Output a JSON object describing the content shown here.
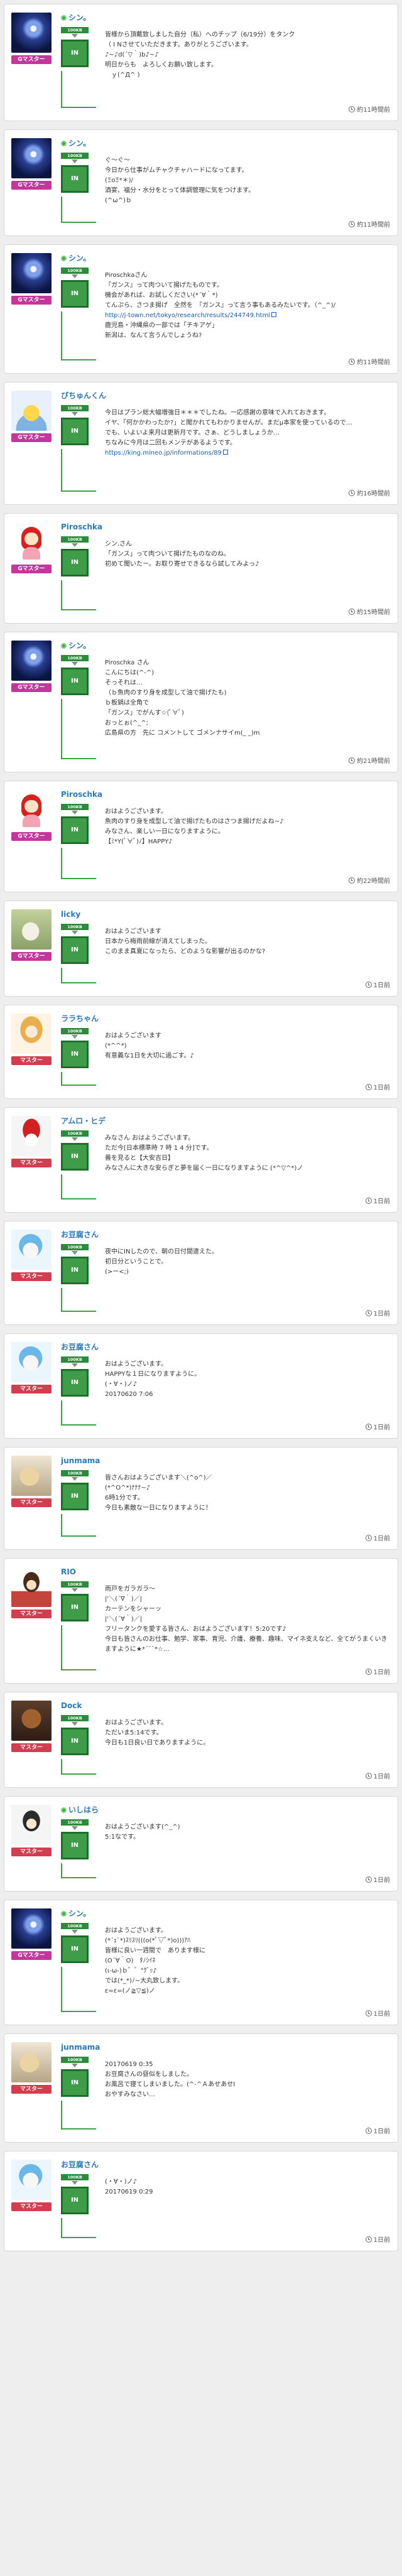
{
  "badge": {
    "top_label": "100KB",
    "main_label": "IN"
  },
  "posts": [
    {
      "name": "シン。",
      "name_flower": true,
      "avatar": "shin",
      "rank": "Gマスター",
      "rank_style": "gm",
      "message": "皆様から頂戴致しました自分（私）へのチップ（6/19分）をタンク\n（ I Nさせていただきます。ありがとうございます。\n♪~♪d(´▽｀)b♪~♪\n明日からも　よろしくお願い致します。\n　ｙ(^Д^ )",
      "time": "約11時間前"
    },
    {
      "name": "シン。",
      "name_flower": true,
      "avatar": "shin",
      "rank": "Gマスター",
      "rank_style": "gm",
      "message": "ぐ～ぐ～\n今日から仕事がムチャクチャハードになってます。\n(ΞoΞ*＊)/\n酒宴、福分・水分をとって体調管理に気をつけます。\n(^ω^)ｂ",
      "time": "約11時間前"
    },
    {
      "name": "シン。",
      "name_flower": true,
      "avatar": "shin",
      "rank": "Gマスター",
      "rank_style": "gm",
      "message": "Piroschkaさん\n『ガンス』って肉ついて揚げたものです。\n機会があれば、お試しください(*´∀｀*)\nてんぷら、さつま揚げ　全然を　『ガンス』って言う事もあるみたいです。（^_^)/\n",
      "link": "http://j-town.net/tokyo/research/results/244749.html",
      "message_after": "鹿児島・沖縄県の一部では「チキアゲ」\n新潟は、なんて言うんでしょうね?",
      "time": "約11時間前"
    },
    {
      "name": "ぴちゅんくん",
      "name_flower": false,
      "avatar": "pichu",
      "rank": "Gマスター",
      "rank_style": "gm",
      "message": "今日はプラン総大幅増強日＊＊＊でしたね。一応感謝の意味で入れておきます。\nイヤ、「何かかわったか?」と聞かれてもわかりませんが。まだμ本家を使っているので…\nでも、いよいよ来月は更新月です。さぁ、どうしましょうか…\nちなみに今月は二回もメンテがあるようです。\n",
      "link": "https://king.mineo.jp/informations/89",
      "message_after": "",
      "time": "約16時間前"
    },
    {
      "name": "Piroschka",
      "name_flower": false,
      "avatar": "pirosh",
      "rank": "Gマスター",
      "rank_style": "gm",
      "message": "シン.さん\n「ガンス」って肉ついて揚げたものなのね。\n初めて聞いたー。お取り寄せできるなら試してみよっ♪",
      "time": "約15時間前"
    },
    {
      "name": "シン。",
      "name_flower": true,
      "avatar": "shin",
      "rank": "Gマスター",
      "rank_style": "gm",
      "message": "Piroschka さん\nこんにちは(^-^)\nそっそれは…\n（ｂ魚肉のすり身を成型して油で揚げたも)\nｂ板鍋は全角で\n「ガンス」でがんす☆(ﾟ∀ﾟ)\nおっとぉ(^_^;\n広島県の方　先に コメントして ゴメンナサイm(_ _)m\n\n",
      "time": "約21時間前"
    },
    {
      "name": "Piroschka",
      "name_flower": false,
      "avatar": "pirosh",
      "rank": "Gマスター",
      "rank_style": "gm",
      "message": "おはようございます。\n魚肉のすり身を成型して油で揚げたものはさつま揚げだよね~♪\nみなさん、楽しい一日になりますように。\n【ﾐ*Y(ﾟ∀ﾟ)ﾉ】HAPPY♪",
      "time": "約22時間前"
    },
    {
      "name": "licky",
      "name_flower": false,
      "avatar": "licky",
      "rank": "Gマスター",
      "rank_style": "gm",
      "message": "おはようございます\n日本から梅雨前線が消えてしまった。\nこのまま真夏になったら、どのような影響が出るのかな?",
      "time": "1日前"
    },
    {
      "name": "ララちゃん",
      "name_flower": false,
      "avatar": "rara",
      "rank": "マスター",
      "rank_style": "m",
      "message": "おはようございます\n(*^^*)\n有意義な1日を大切に過ごす。♪",
      "time": "1日前"
    },
    {
      "name": "アムロ・ヒデ",
      "name_flower": false,
      "avatar": "amuro",
      "rank": "マスター",
      "rank_style": "m",
      "message": "みなさん おはようございます。\nただ今[日本標準時 7 時 1 4 分]です。\n曇を見ると【大安吉日】\nみなさんに大きな安らぎと夢を届く一日になりますように (*^▽^*)ノ",
      "time": "1日前"
    },
    {
      "name": "お豆腐さん",
      "name_flower": false,
      "avatar": "otofu",
      "rank": "マスター",
      "rank_style": "m",
      "message": "夜中にINしたので、朝の日付間違えた。\n初日分ということで。\n(>ー<;)",
      "time": "1日前"
    },
    {
      "name": "お豆腐さん",
      "name_flower": false,
      "avatar": "otofu",
      "rank": "マスター",
      "rank_style": "m",
      "message": "おはようございます。\nHAPPYな１日になりますように。\n(・∀・)ノ♪\n20170620 7:06",
      "time": "1日前"
    },
    {
      "name": "junmama",
      "name_flower": false,
      "avatar": "jun",
      "rank": "マスター",
      "rank_style": "m",
      "message": "皆さんおはようございます＼(^o^)／\n(*^O^*)ﾅﾅﾅ~♪\n6時1分です。\n今日も素敵な一日になりますように！",
      "time": "1日前"
    },
    {
      "name": "RIO",
      "name_flower": false,
      "avatar": "rio",
      "rank": "マスター",
      "rank_style": "m",
      "message": "雨戸をガラガラ～\n|'＼(´∇｀)／|\nカーテンをシャーッ\n|'＼(´∀｀)／|\nフリータンクを愛する皆さん、おはようございます！5:20です♪\n今日も皆さんのお仕事、勉学、家事、育児、介護、療養、趣味、マイネ支えなど、全てがうまくいきますように★*´¨`*☆…",
      "time": "1日前"
    },
    {
      "name": "Dock",
      "name_flower": false,
      "avatar": "dock",
      "rank": "マスター",
      "rank_style": "m",
      "message": "おはようございます。\nただいま5:14です。\n今日も1日良い日でありますように。",
      "time": "1日前"
    },
    {
      "name": "いしはら",
      "name_flower": true,
      "avatar": "ishi",
      "rank": "マスター",
      "rank_style": "m",
      "message": "おはようございます(^_^)\n5:1なです。",
      "time": "1日前"
    },
    {
      "name": "シン。",
      "name_flower": true,
      "avatar": "shin",
      "rank": "Gマスター",
      "rank_style": "gm",
      "message": "おはようございます。\n(*´ｪ`*)ｽﾘｽﾘ(((o(*ﾟ▽ﾟ*)o)))ｱﾊ\n皆様に良い一週間で　あります様に\n(O´∀｀O)　ﾀﾉｼｲﾈ\n(ι-ω-)ｂ゛゛\"ｸﾞｯ♪\nでは(*_*)ﾉ~大丸致します。\nε=ε=(ノ≧▽≦)ノ",
      "time": "1日前"
    },
    {
      "name": "junmama",
      "name_flower": false,
      "avatar": "jun",
      "rank": "マスター",
      "rank_style": "m",
      "message": "20170619 0:35\nお豆腐さんの昼似をしました。\nお風呂で寝てしまいました。(^-^ＡあせあせI\nおやすみなさい…",
      "time": "1日前"
    },
    {
      "name": "お豆腐さん",
      "name_flower": false,
      "avatar": "otofu",
      "rank": "マスター",
      "rank_style": "m",
      "message": "(・∀・)ノ♪\n20170619 0:29",
      "time": "1日前"
    }
  ]
}
